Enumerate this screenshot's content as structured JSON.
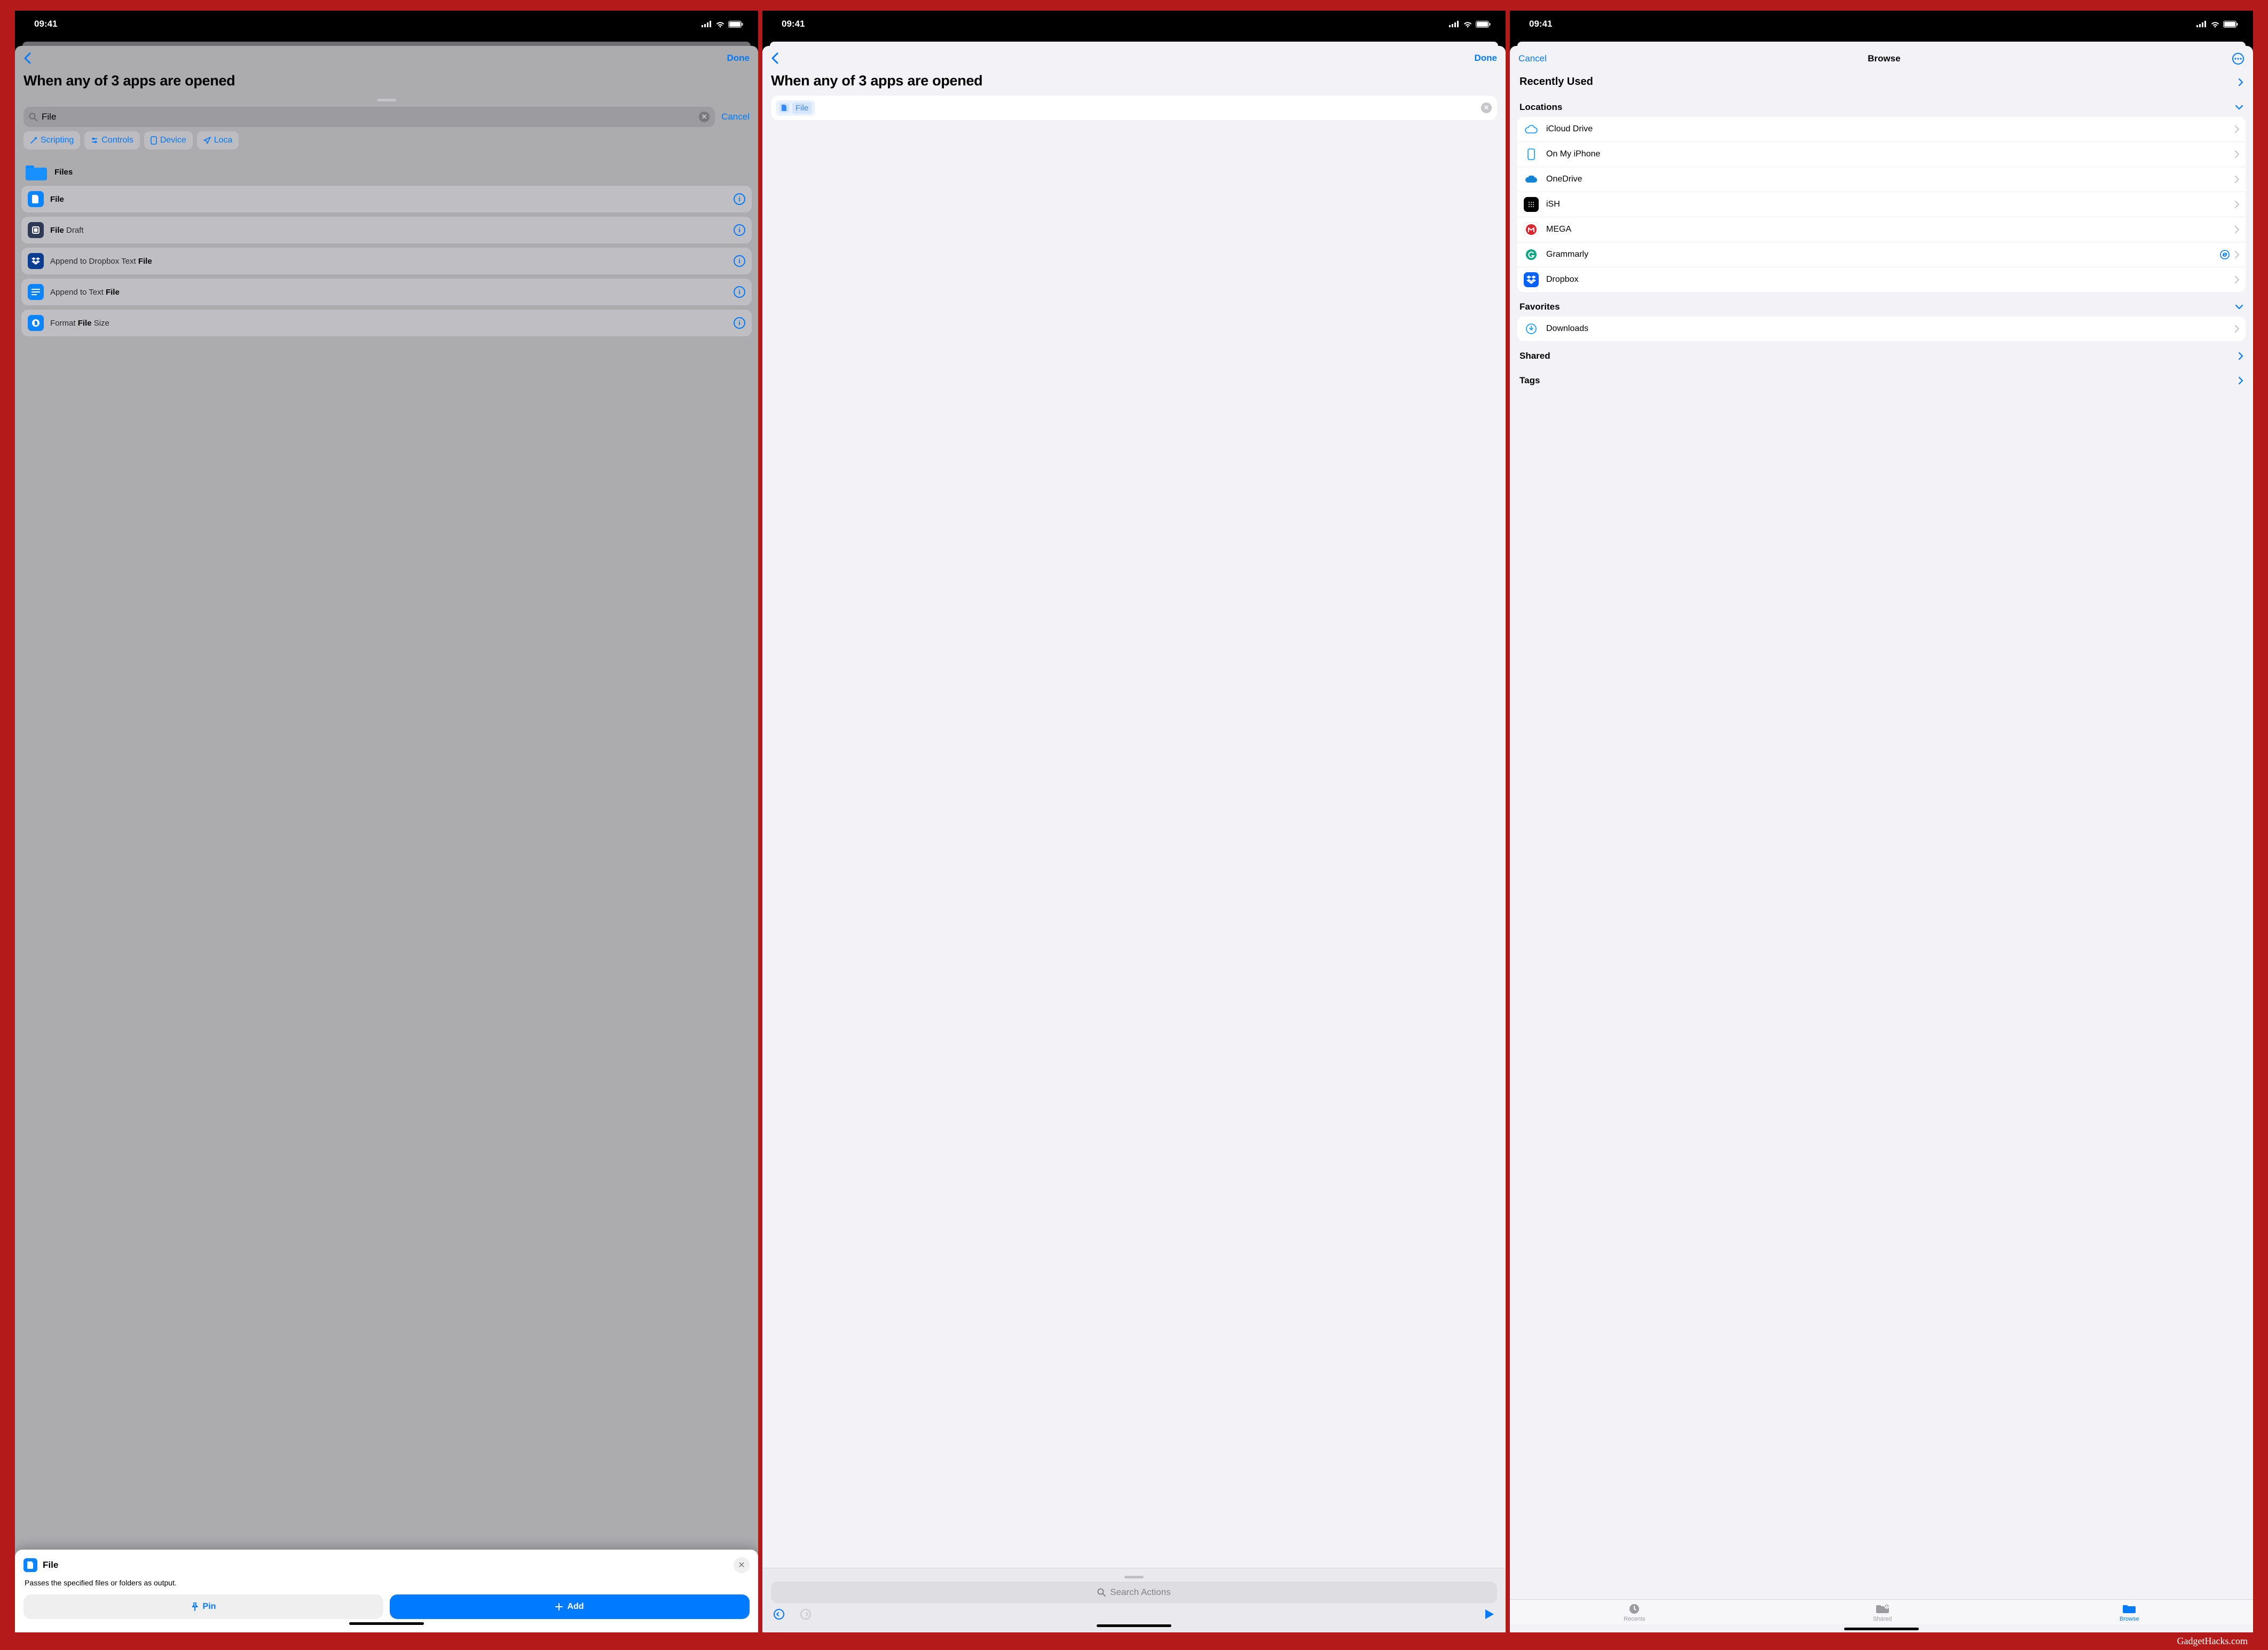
{
  "status": {
    "time": "09:41"
  },
  "common": {
    "done": "Done",
    "cancel": "Cancel",
    "heading": "When any of 3 apps are opened"
  },
  "p1": {
    "search_value": "File",
    "chips": [
      "Scripting",
      "Controls",
      "Device",
      "Loca"
    ],
    "group_label": "Files",
    "actions": [
      {
        "pre": "",
        "bold": "File",
        "post": ""
      },
      {
        "pre": "",
        "bold": "File",
        "post": " Draft"
      },
      {
        "pre": "Append to Dropbox Text ",
        "bold": "File",
        "post": ""
      },
      {
        "pre": "Append to Text ",
        "bold": "File",
        "post": ""
      },
      {
        "pre": "Format ",
        "bold": "File",
        "post": " Size"
      }
    ],
    "popover": {
      "title": "File",
      "desc": "Passes the specified files or folders as output.",
      "pin": "Pin",
      "add": "Add"
    }
  },
  "p2": {
    "token": "File",
    "search_actions": "Search Actions"
  },
  "p3": {
    "nav_title": "Browse",
    "recently_used": "Recently Used",
    "locations_header": "Locations",
    "locations": [
      {
        "name": "iCloud Drive"
      },
      {
        "name": "On My iPhone"
      },
      {
        "name": "OneDrive"
      },
      {
        "name": "iSH"
      },
      {
        "name": "MEGA"
      },
      {
        "name": "Grammarly",
        "sync": true
      },
      {
        "name": "Dropbox"
      }
    ],
    "favorites_header": "Favorites",
    "favorites": [
      {
        "name": "Downloads"
      }
    ],
    "shared": "Shared",
    "tags": "Tags",
    "tabs": {
      "recents": "Recents",
      "shared": "Shared",
      "browse": "Browse"
    }
  },
  "credit": "GadgetHacks.com"
}
